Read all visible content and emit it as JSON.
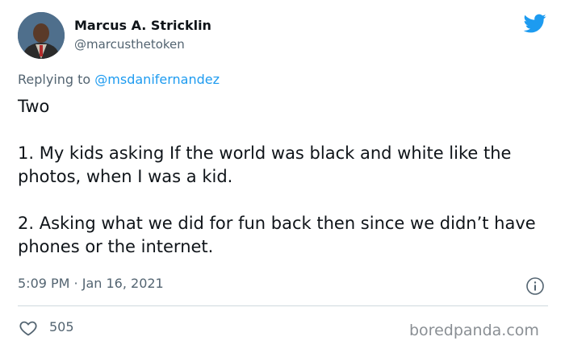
{
  "author": {
    "name": "Marcus A. Stricklin",
    "handle": "@marcusthetoken"
  },
  "reply": {
    "prefix": "Replying to ",
    "mention": "@msdanifernandez"
  },
  "tweet": {
    "line1": "Two",
    "line2": "1. My kids asking If the world was black and white like the photos, when I was a kid.",
    "line3": "2. Asking what we did for fun back then since we didn’t have phones or the internet."
  },
  "meta": {
    "timestamp": "5:09 PM · Jan 16, 2021"
  },
  "stats": {
    "likes": "505"
  },
  "watermark": "boredpanda.com",
  "colors": {
    "twitter_blue": "#1d9bf0",
    "secondary_text": "#536471"
  },
  "icons": {
    "logo": "twitter-bird-icon",
    "info": "info-icon",
    "like": "heart-icon"
  }
}
